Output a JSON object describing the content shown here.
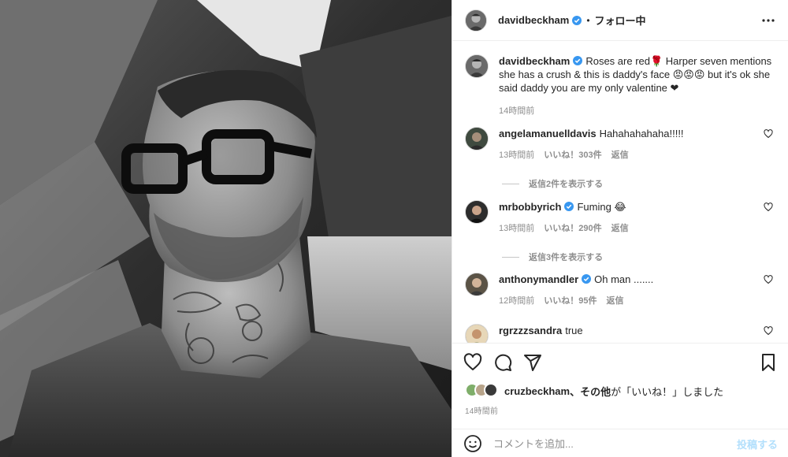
{
  "header": {
    "username": "davidbeckham",
    "separator": "•",
    "follow_label": "フォロー中"
  },
  "caption": {
    "username": "davidbeckham",
    "text": "Roses are red🌹 Harper seven mentions she has a crush & this is daddy's face 😡😡😡 but it's ok she said daddy you are my only valentine ❤",
    "time": "14時間前"
  },
  "comments": [
    {
      "username": "angelamanuelldavis",
      "text": "Hahahahahaha!!!!!",
      "time": "13時間前",
      "likes": "いいね！303件",
      "reply": "返信",
      "view_replies": "返信2件を表示する"
    },
    {
      "username": "mrbobbyrich",
      "text": "Fuming 😂",
      "time": "13時間前",
      "likes": "いいね！290件",
      "reply": "返信",
      "view_replies": "返信3件を表示する"
    },
    {
      "username": "anthonymandler",
      "text": "Oh man .......",
      "time": "12時間前",
      "likes": "いいね！95件",
      "reply": "返信"
    },
    {
      "username": "rgrzzzsandra",
      "text": "true"
    }
  ],
  "likes_summary": {
    "username": "cruzbeckham",
    "rest": "、その他",
    "suffix": "が「いいね！」しました"
  },
  "post_time": "14時間前",
  "add_comment": {
    "placeholder": "コメントを追加...",
    "post_label": "投稿する"
  },
  "colors": {
    "verified": "#3897f0",
    "post_button_disabled": "#b2dffc",
    "secondary_text": "#8e8e8e"
  },
  "icons": [
    "more-icon",
    "verified-icon",
    "heart-icon",
    "comment-icon",
    "share-icon",
    "bookmark-icon",
    "emoji-icon"
  ]
}
